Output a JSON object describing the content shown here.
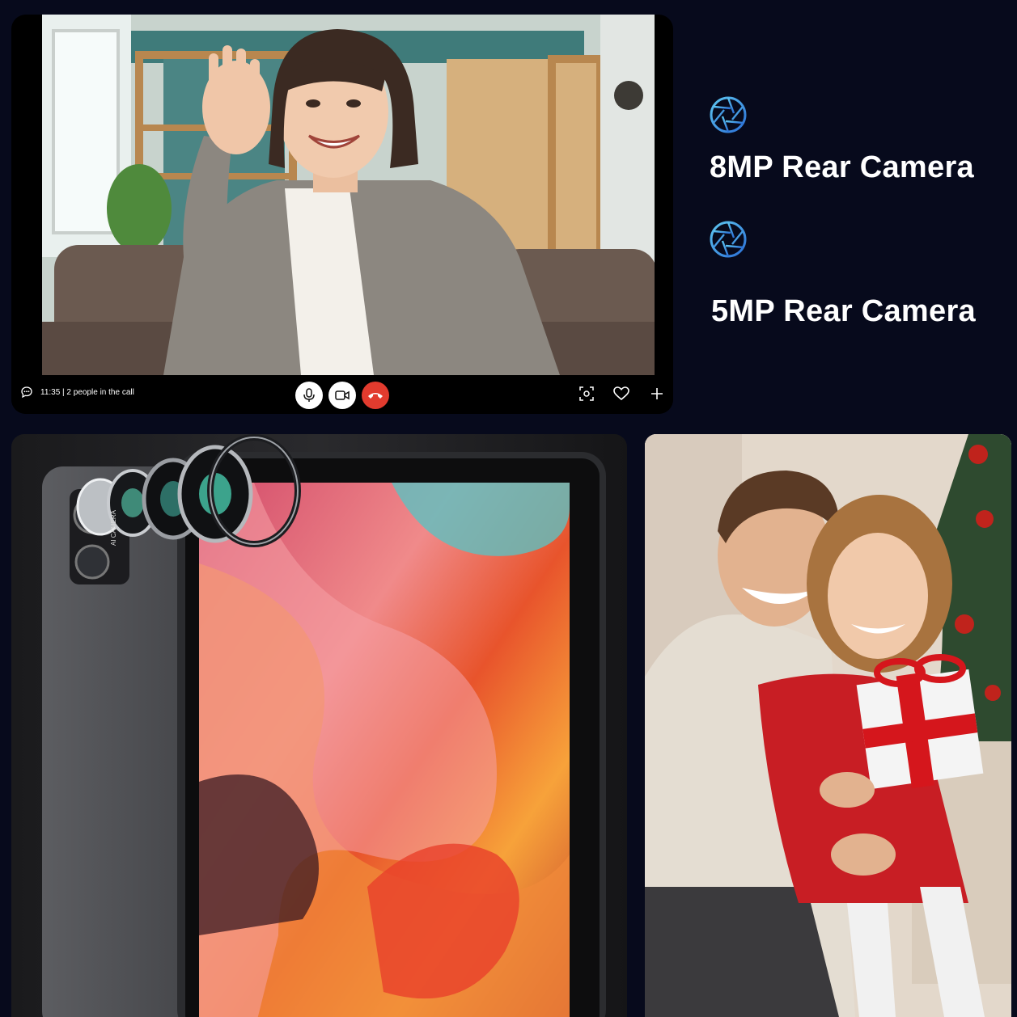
{
  "call": {
    "status_text": "11:35 | 2 people in the call",
    "icons": {
      "chat": "chat-bubble-icon",
      "mic": "microphone-icon",
      "video": "video-camera-icon",
      "hangup": "hang-up-icon",
      "screenshot": "screenshot-icon",
      "favorite": "heart-icon",
      "add": "plus-icon"
    },
    "colors": {
      "hangup": "#e23b2e",
      "bar": "#000000"
    }
  },
  "features": [
    {
      "label": "8MP Rear Camera",
      "icon": "camera-aperture-icon"
    },
    {
      "label": "5MP Rear Camera",
      "icon": "camera-aperture-icon"
    }
  ],
  "tablet": {
    "camera_label": "AI CAMERA"
  },
  "colors": {
    "background": "#070a1c",
    "accent": "#3a8fd8"
  }
}
